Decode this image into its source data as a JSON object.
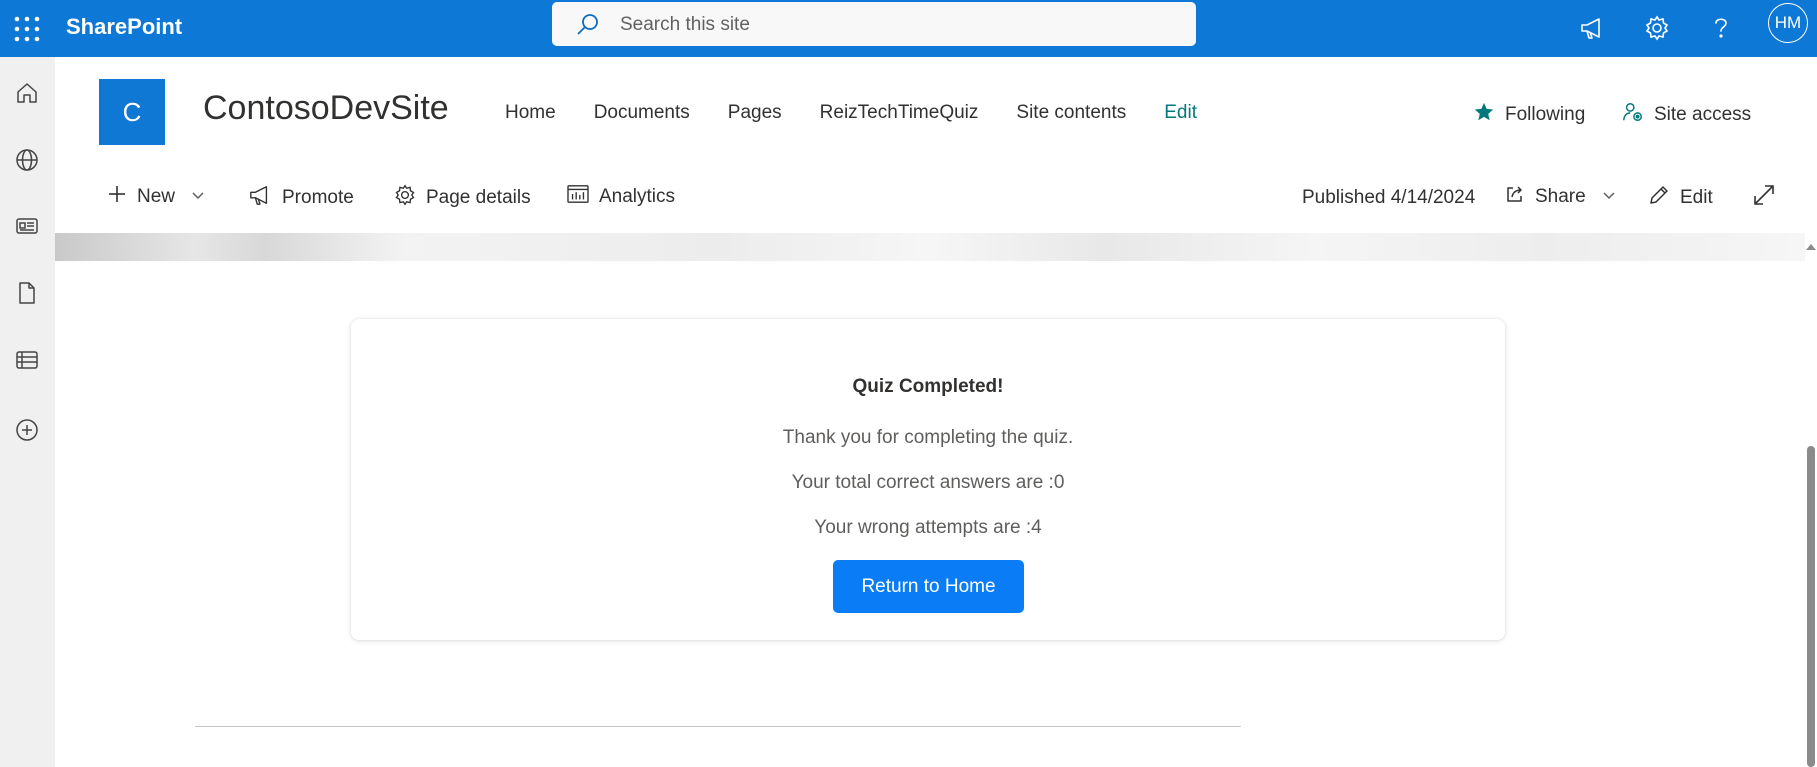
{
  "suitebar": {
    "brand": "SharePoint",
    "search_placeholder": "Search this site",
    "avatar_initials": "HM",
    "accent": "#0f78d4"
  },
  "rail": {
    "icons": [
      "home-icon",
      "globe-icon",
      "news-icon",
      "document-icon",
      "list-icon",
      "add-icon"
    ]
  },
  "site": {
    "logo_letter": "C",
    "title": "ContosoDevSite",
    "nav": [
      "Home",
      "Documents",
      "Pages",
      "ReizTechTimeQuiz",
      "Site contents",
      "Edit"
    ],
    "following": "Following",
    "site_access": "Site access"
  },
  "command_bar": {
    "new": "New",
    "promote": "Promote",
    "page_details": "Page details",
    "analytics": "Analytics",
    "published": "Published 4/14/2024",
    "share": "Share",
    "edit": "Edit"
  },
  "quiz": {
    "title": "Quiz Completed!",
    "thanks": "Thank you for completing the quiz.",
    "correct": "Your total correct answers are :0",
    "wrong": "Your wrong attempts are :4",
    "button": "Return to Home",
    "button_color": "#0a7cf5"
  }
}
